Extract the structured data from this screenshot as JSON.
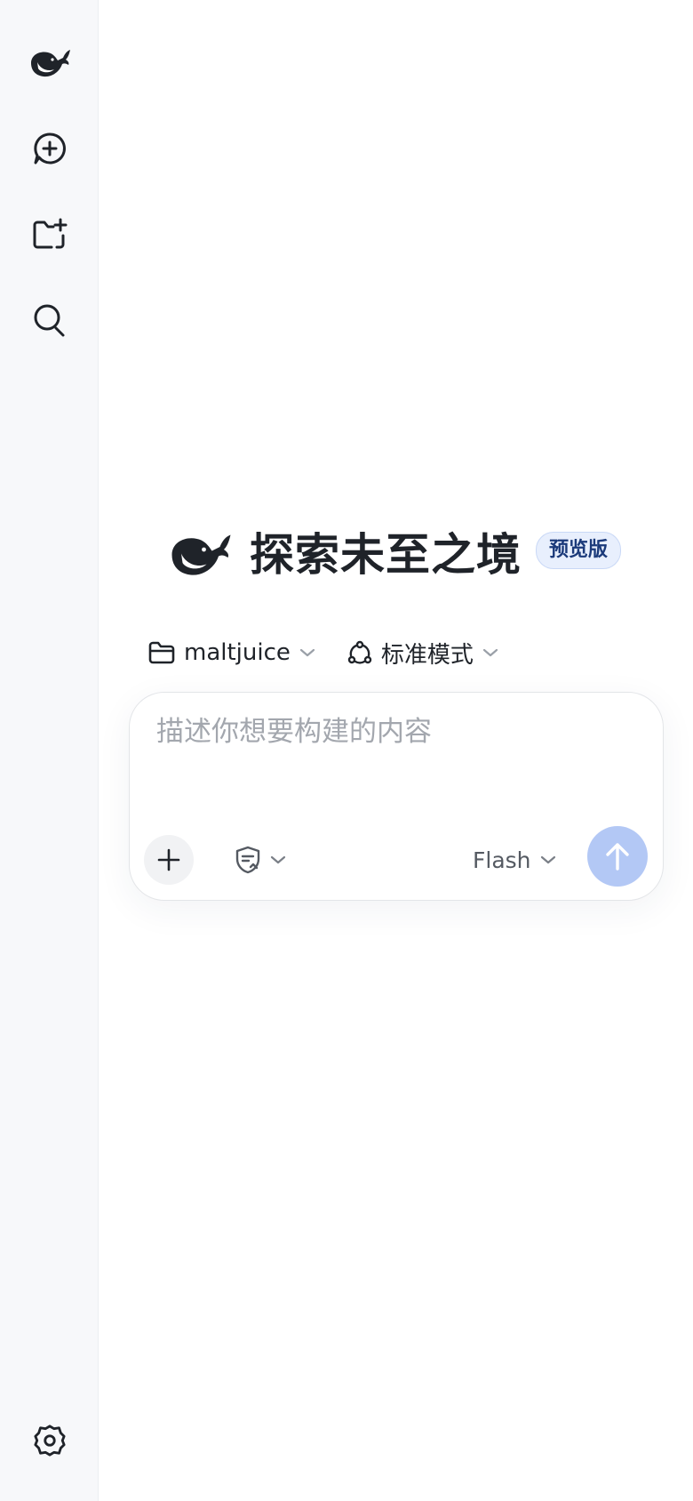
{
  "sidebar": {
    "logo_icon": "deepseek-whale-icon",
    "items": [
      {
        "name": "new-chat",
        "icon": "chat-plus-icon"
      },
      {
        "name": "new-project",
        "icon": "folder-plus-icon"
      },
      {
        "name": "search",
        "icon": "search-icon"
      }
    ],
    "settings_icon": "gear-icon"
  },
  "hero": {
    "title": "探索未至之境",
    "badge": "预览版"
  },
  "selectors": {
    "project": {
      "icon": "folder-icon",
      "label": "maltjuice"
    },
    "mode": {
      "icon": "nodes-icon",
      "label": "标准模式"
    }
  },
  "composer": {
    "placeholder": "描述你想要构建的内容",
    "value": "",
    "attach_icon": "plus-icon",
    "guard_icon": "shield-list-icon",
    "model": "Flash",
    "send_icon": "arrow-up-icon"
  },
  "colors": {
    "sidebar_bg": "#f7f8fa",
    "badge_bg": "#e8effd",
    "badge_text": "#1b3a7a",
    "send_button": "#b3c8f5",
    "placeholder_text": "#a3a7ae"
  }
}
